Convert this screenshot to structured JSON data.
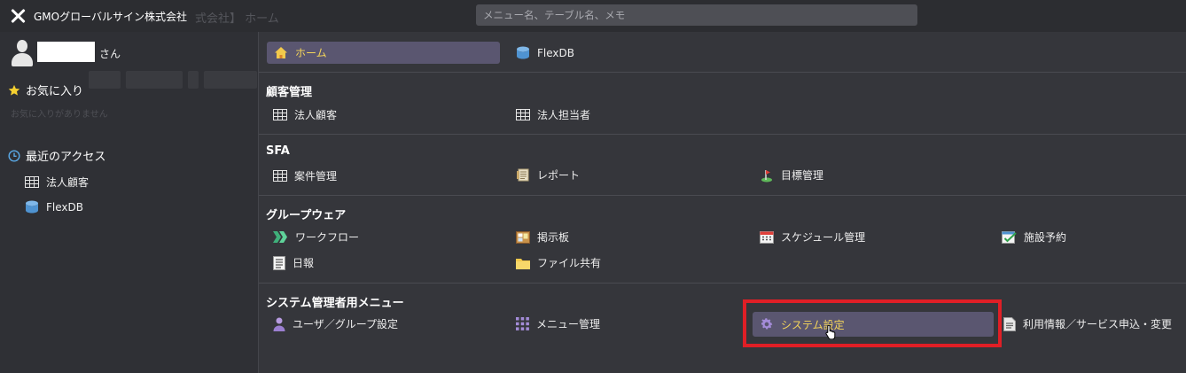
{
  "topbar": {
    "company": "GMOグローバルサイン株式会社",
    "ghost_title": "式会社】 ホーム",
    "search_placeholder": "メニュー名、テーブル名、メモ"
  },
  "sidebar": {
    "user_suffix": "さん",
    "favorites_label": "お気に入り",
    "ghost_text": "お気に入りがありません",
    "recent_label": "最近のアクセス",
    "recent_items": [
      {
        "label": "法人顧客",
        "icon": "table-icon"
      },
      {
        "label": "FlexDB",
        "icon": "database-icon"
      }
    ]
  },
  "main": {
    "home_label": "ホーム",
    "flexdb_label": "FlexDB",
    "sections": {
      "customer": {
        "title": "顧客管理",
        "items": [
          "法人顧客",
          "法人担当者"
        ]
      },
      "sfa": {
        "title": "SFA",
        "items": [
          "案件管理",
          "レポート",
          "目標管理"
        ]
      },
      "groupware": {
        "title": "グループウェア",
        "items": [
          "ワークフロー",
          "掲示板",
          "スケジュール管理",
          "施設予約",
          "日報",
          "ファイル共有"
        ]
      },
      "admin": {
        "title": "システム管理者用メニュー",
        "items": [
          "ユーザ／グループ設定",
          "メニュー管理",
          "システム設定",
          "利用情報／サービス申込・変更"
        ]
      }
    }
  },
  "colors": {
    "accent": "#f5d65a",
    "selected_bg": "#5a5670",
    "highlight_border": "#e01f26"
  }
}
